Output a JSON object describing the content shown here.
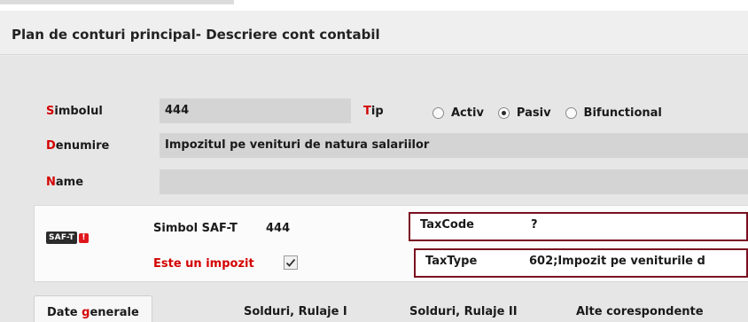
{
  "window": {
    "title": "Plan de conturi principal- Descriere cont contabil"
  },
  "form": {
    "simbolul": {
      "label_first": "S",
      "label_rest": "imbolul",
      "value": "444"
    },
    "tip": {
      "label_first": "T",
      "label_rest": "ip",
      "options": [
        {
          "label": "Activ",
          "selected": false
        },
        {
          "label": "Pasiv",
          "selected": true
        },
        {
          "label": "Bifunctional",
          "selected": false
        }
      ]
    },
    "denumire": {
      "label_first": "D",
      "label_rest": "enumire",
      "value": "Impozitul pe venituri de natura salariilor"
    },
    "name": {
      "label_first": "N",
      "label_rest": "ame",
      "value": ""
    }
  },
  "saft": {
    "logo_text": "SAF-T",
    "logo_badge": "!",
    "simbol_label": "Simbol SAF-T",
    "simbol_value": "444",
    "impozit_label": "Este un impozit",
    "impozit_checked": true,
    "taxcode_label": "TaxCode",
    "taxcode_value": "?",
    "taxtype_label": "TaxType",
    "taxtype_value": "602;Impozit pe veniturile d"
  },
  "tabs": [
    {
      "pre": "Date ",
      "acc": "g",
      "post": "enerale",
      "active": true
    },
    {
      "pre": "Solduri, Rulaje I",
      "acc": "",
      "post": "",
      "active": false
    },
    {
      "pre": "Solduri, Rulaje II",
      "acc": "",
      "post": "",
      "active": false
    },
    {
      "pre": "Alte corespondente",
      "acc": "",
      "post": "",
      "active": false
    }
  ],
  "colors": {
    "accent_red": "#d40000",
    "highlight_border": "#7a1020",
    "field_bg": "#d4d4d4"
  }
}
